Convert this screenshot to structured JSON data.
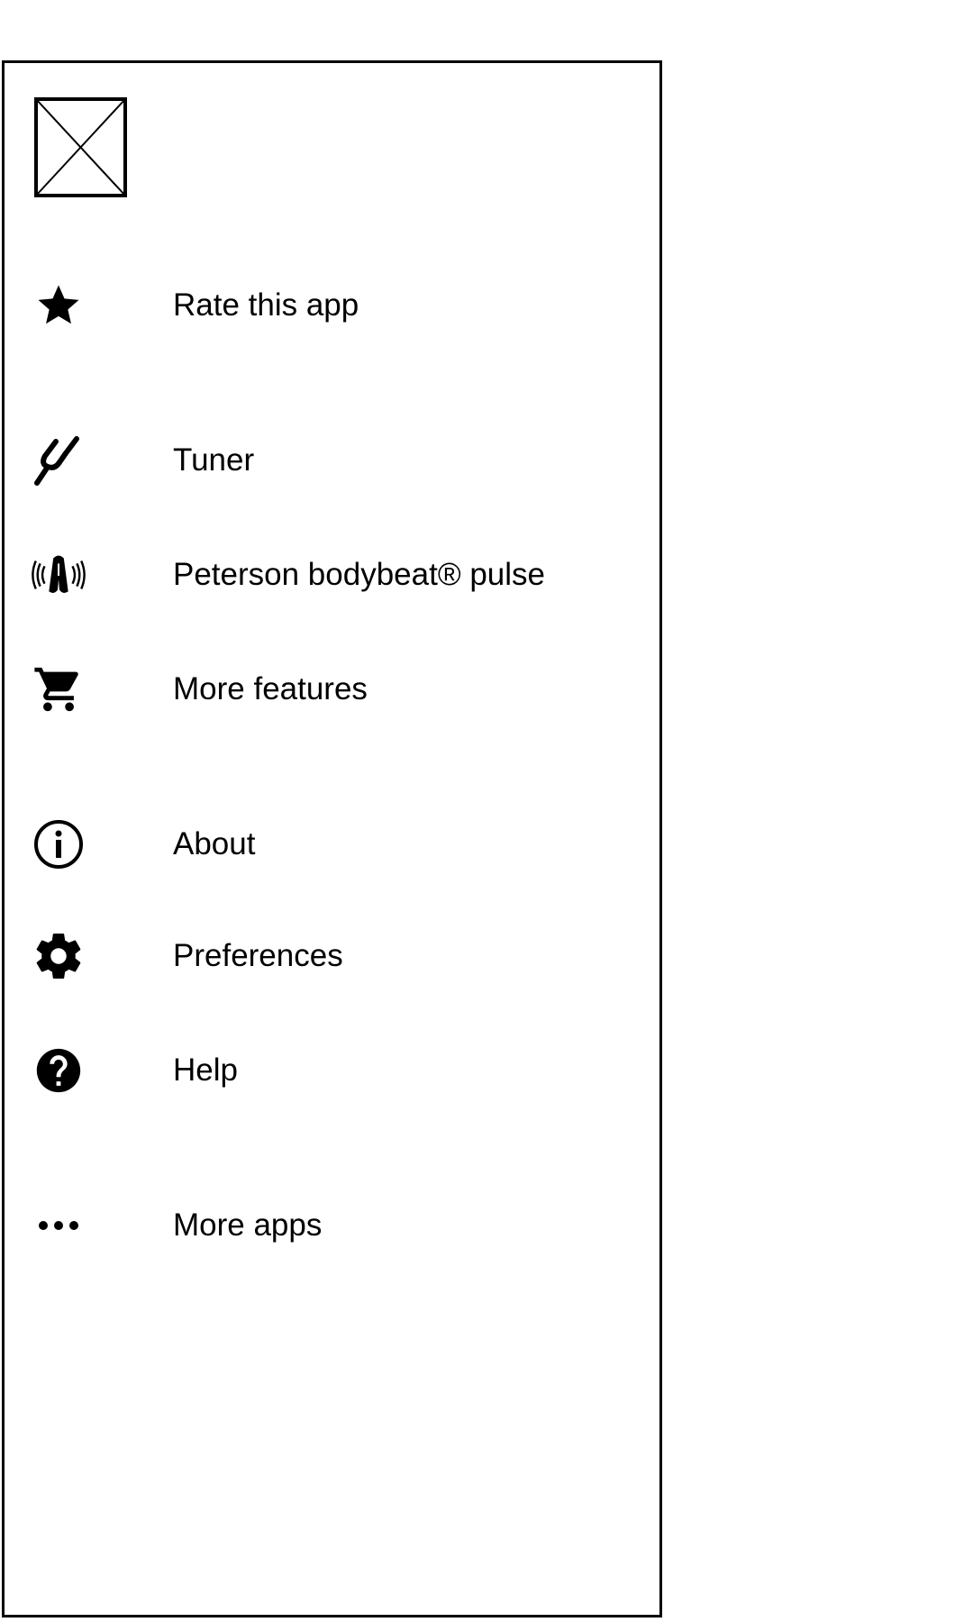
{
  "drawer": {
    "header_image": "image-placeholder",
    "items": [
      {
        "label": "Rate this app",
        "icon": "star-icon"
      },
      {
        "label": "Tuner",
        "icon": "tuning-fork-icon"
      },
      {
        "label": "Peterson bodybeat® pulse",
        "icon": "bodybeat-pulse-icon"
      },
      {
        "label": "More features",
        "icon": "cart-icon"
      },
      {
        "label": "About",
        "icon": "info-icon"
      },
      {
        "label": "Preferences",
        "icon": "gear-icon"
      },
      {
        "label": "Help",
        "icon": "help-icon"
      },
      {
        "label": "More apps",
        "icon": "more-dots-icon"
      }
    ]
  },
  "colors": {
    "foreground": "#000000",
    "background": "#ffffff"
  }
}
